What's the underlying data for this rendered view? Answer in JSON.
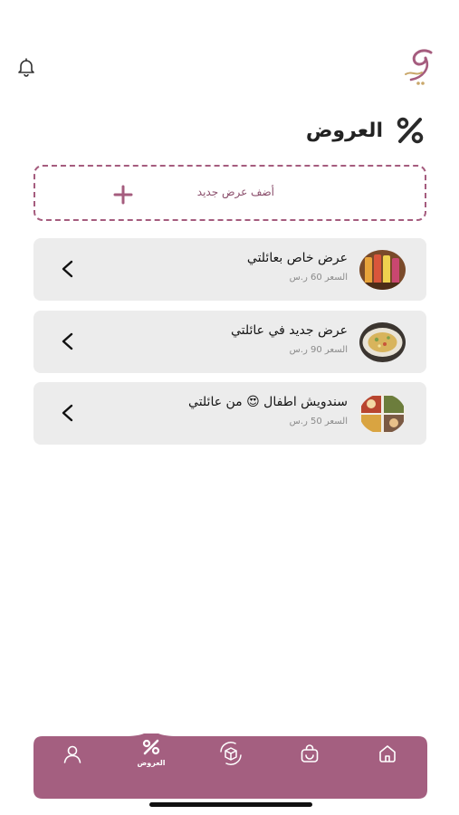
{
  "header": {
    "title": "العروض",
    "icons": {
      "notifications": "bell-icon",
      "logo": "brand-logo",
      "title": "percent-icon"
    }
  },
  "add_offer": {
    "label": "أضف عرض جديد",
    "icon": "plus-icon"
  },
  "offers": [
    {
      "name": "عرض خاص بعائلتي",
      "price": "السعر 60 ر.س",
      "image": "juice-jars"
    },
    {
      "name": "عرض جديد في عائلتي",
      "price": "السعر 90 ر.س",
      "image": "food-plate"
    },
    {
      "name": "سندويش اطفال 😍 من عائلتي",
      "price": "السعر 50 ر.س",
      "image": "sandwich-collage"
    }
  ],
  "bottom_nav": {
    "items": [
      {
        "id": "profile",
        "icon": "user-icon",
        "label": ""
      },
      {
        "id": "offers",
        "icon": "percent-icon",
        "label": "العروض",
        "active": true
      },
      {
        "id": "exchange",
        "icon": "box-cycle-icon",
        "label": ""
      },
      {
        "id": "bag",
        "icon": "bag-icon",
        "label": ""
      },
      {
        "id": "home",
        "icon": "home-icon",
        "label": ""
      }
    ]
  },
  "colors": {
    "brand": "#a55c7e",
    "nav_background": "#a45f80",
    "card_background": "#ececec",
    "text_primary": "#1f1f1f",
    "text_muted": "#8a8a8a"
  }
}
